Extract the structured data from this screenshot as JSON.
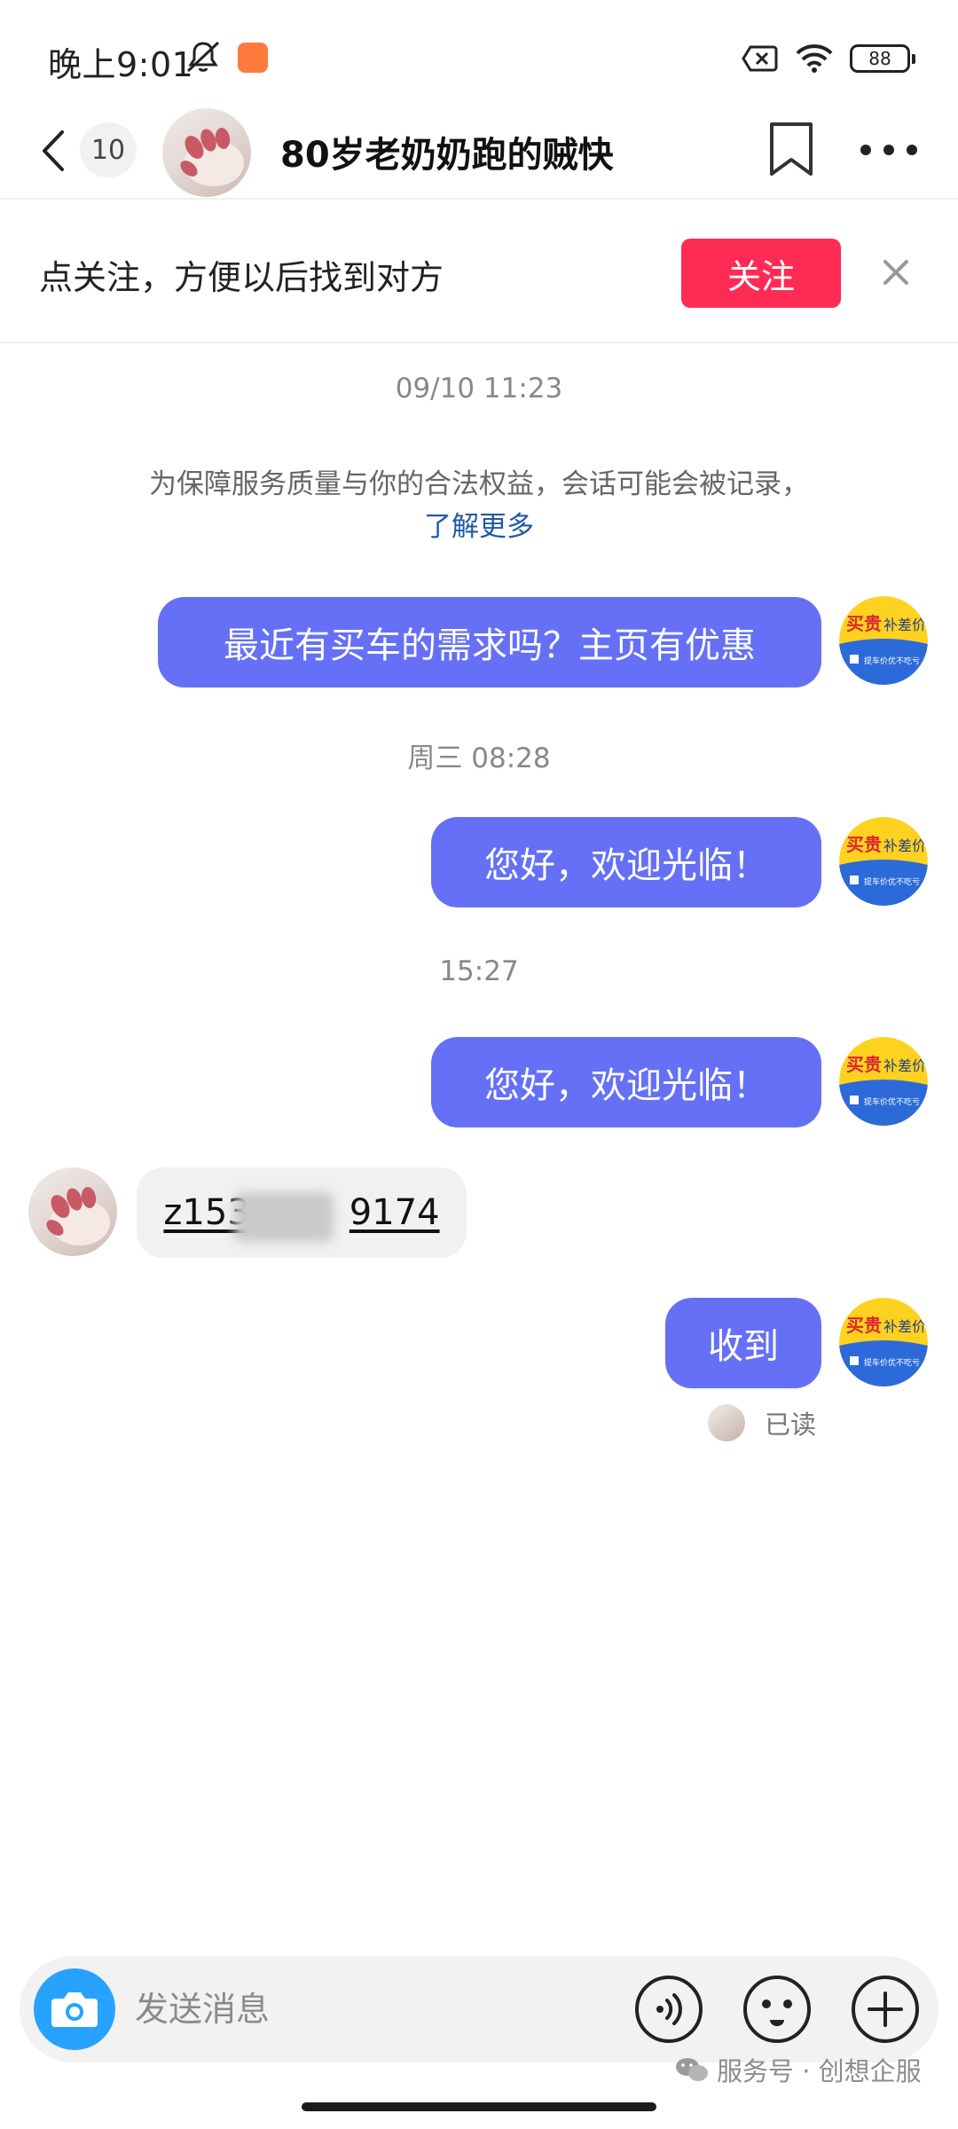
{
  "status_bar": {
    "time": "晚上9:01",
    "battery": "88"
  },
  "header": {
    "unread_count": "10",
    "contact_name": "80岁老奶奶跑的贼快"
  },
  "follow_bar": {
    "tip": "点关注，方便以后找到对方",
    "follow_label": "关注"
  },
  "chat": {
    "notice_text": "为保障服务质量与你的合法权益，会话可能会被记录，",
    "notice_link": "了解更多",
    "timestamps": [
      "09/10 11:23",
      "周三 08:28",
      "15:27"
    ],
    "messages": [
      {
        "side": "me",
        "text": "最近有买车的需求吗？主页有优惠"
      },
      {
        "side": "me",
        "text": "您好，欢迎光临！"
      },
      {
        "side": "me",
        "text": "您好，欢迎光临！"
      },
      {
        "side": "them",
        "text_prefix": "z153",
        "text_suffix": "9174"
      },
      {
        "side": "me",
        "text": "收到"
      }
    ],
    "read_label": "已读"
  },
  "my_avatar": {
    "badge_text": "买贵",
    "badge_tag": "补差价",
    "subtext": "提车价优不吃亏"
  },
  "input_bar": {
    "placeholder": "发送消息"
  },
  "watermark": {
    "text": "服务号 · 创想企服"
  },
  "colors": {
    "accent_bubble": "#6570f6",
    "follow_button": "#fe2c55",
    "camera": "#27a3ff",
    "link": "#1f5aa6"
  },
  "icons": [
    "mute-icon",
    "back-arrow-icon",
    "bookmark-icon",
    "more-dots-icon",
    "close-icon",
    "camera-icon",
    "voice-icon",
    "emoji-icon",
    "plus-icon",
    "wechat-icon"
  ]
}
